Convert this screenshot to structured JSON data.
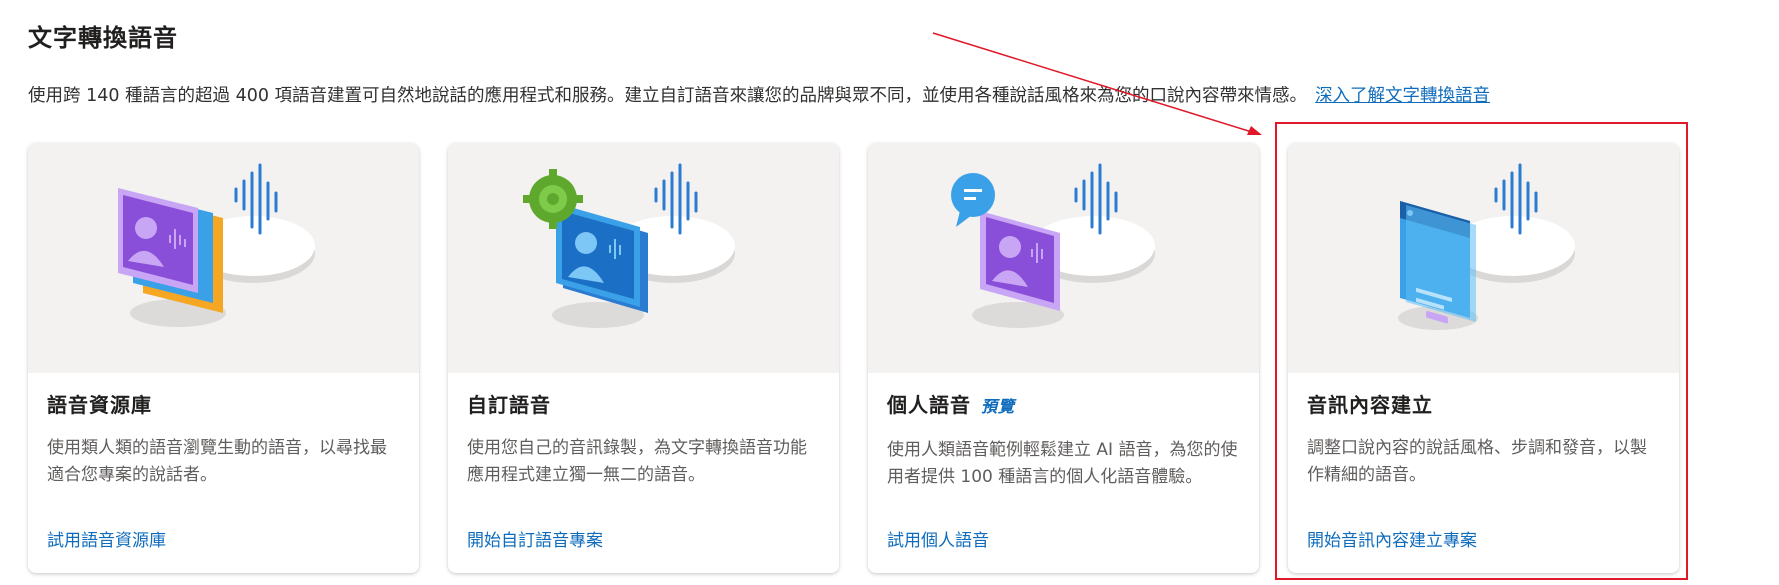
{
  "header": {
    "title": "文字轉換語音",
    "description": "使用跨 140 種語言的超過 400 項語音建置可自然地說話的應用程式和服務。建立自訂語音來讓您的品牌與眾不同，並使用各種說話風格來為您的口說內容帶來情感。",
    "learn_more_link": "深入了解文字轉換語音"
  },
  "cards": [
    {
      "title": "語音資源庫",
      "badge": "",
      "text": "使用類人類的語音瀏覽生動的語音，以尋找最適合您專案的說話者。",
      "link": "試用語音資源庫"
    },
    {
      "title": "自訂語音",
      "badge": "",
      "text": "使用您自己的音訊錄製，為文字轉換語音功能應用程式建立獨一無二的語音。",
      "link": "開始自訂語音專案"
    },
    {
      "title": "個人語音",
      "badge": "預覽",
      "text": "使用人類語音範例輕鬆建立 AI 語音，為您的使用者提供 100 種語言的個人化語音體驗。",
      "link": "試用個人語音"
    },
    {
      "title": "音訊內容建立",
      "badge": "",
      "text": "調整口說內容的說話風格、步調和發音，以製作精細的語音。",
      "link": "開始音訊內容建立專案"
    }
  ],
  "colors": {
    "link": "#0f6cbd",
    "card_media_bg": "#f3f2f1",
    "annotation_red": "#e0182a",
    "purple": "#8a4fd8",
    "blue": "#3aa0e8",
    "orange": "#f5a623",
    "green": "#5ea82e"
  },
  "icons": [
    "voice-gallery-illustration",
    "custom-voice-illustration",
    "personal-voice-illustration",
    "audio-content-creation-illustration",
    "sound-wave-icon",
    "gear-icon",
    "chat-bubble-icon"
  ]
}
